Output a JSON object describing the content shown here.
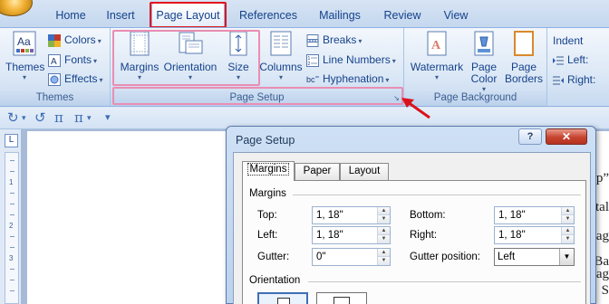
{
  "tabs": [
    "Home",
    "Insert",
    "Page Layout",
    "References",
    "Mailings",
    "Review",
    "View"
  ],
  "active_tab": "Page Layout",
  "ribbon": {
    "themes_group": {
      "label": "Themes",
      "themes_btn": "Themes",
      "colors": "Colors",
      "fonts": "Fonts",
      "effects": "Effects"
    },
    "page_setup_group": {
      "label": "Page Setup",
      "margins": "Margins",
      "orientation": "Orientation",
      "size": "Size",
      "columns": "Columns",
      "breaks": "Breaks",
      "line_numbers": "Line Numbers",
      "hyphenation": "Hyphenation"
    },
    "page_background_group": {
      "label": "Page Background",
      "watermark": "Watermark",
      "page_color_1": "Page",
      "page_color_2": "Color",
      "page_borders_1": "Page",
      "page_borders_2": "Borders"
    },
    "paragraph_group": {
      "indent": "Indent",
      "left": "Left:",
      "right": "Right:"
    }
  },
  "qat_icons": [
    "redo-icon",
    "undo-icon",
    "pi-icon",
    "pi-dropdown-icon",
    "customize-icon"
  ],
  "document_fragments": [
    "p”",
    "tal",
    "ag",
    "Ba",
    "ag",
    "S"
  ],
  "ruler_numbers": [
    "1",
    "2",
    "3"
  ],
  "dialog": {
    "title": "Page Setup",
    "help": "?",
    "close": "✕",
    "tabs": [
      "Margins",
      "Paper",
      "Layout"
    ],
    "active_tab": "Margins",
    "margins_section": "Margins",
    "top_label": "Top:",
    "top_value": "1, 18\"",
    "bottom_label": "Bottom:",
    "bottom_value": "1, 18\"",
    "left_label": "Left:",
    "left_value": "1, 18\"",
    "right_label": "Right:",
    "right_value": "1, 18\"",
    "gutter_label": "Gutter:",
    "gutter_value": "0\"",
    "gutter_position_label": "Gutter position:",
    "gutter_position_value": "Left",
    "orientation_section": "Orientation"
  },
  "colors": {
    "highlight_red": "#e0141e",
    "highlight_pink": "#ea8db2",
    "arrow_red": "#d9121b",
    "ribbon_text": "#15428b"
  }
}
